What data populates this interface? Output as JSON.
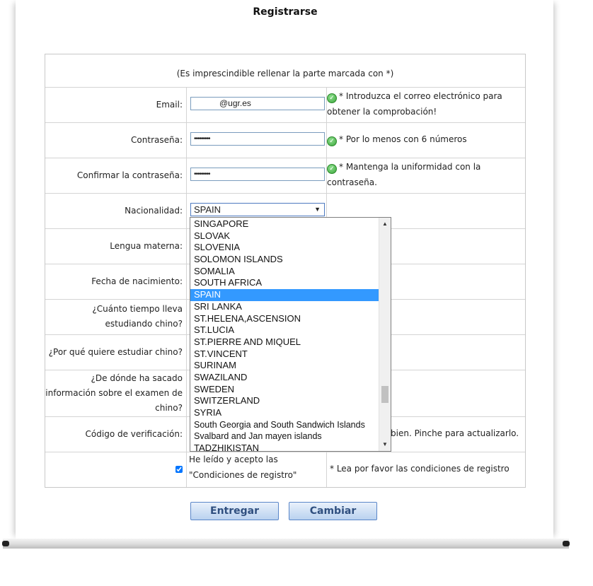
{
  "page": {
    "title": "Registrarse"
  },
  "form": {
    "note": "(Es imprescindible rellenar la parte marcada con *)",
    "email": {
      "label": "Email:",
      "value": "@ugr.es",
      "hint": "* Introduzca el correo electrónico para obtener la comprobación!"
    },
    "password": {
      "label": "Contraseña:",
      "value": "•••••••••",
      "hint": "* Por lo menos con 6 números"
    },
    "confirm": {
      "label": "Confirmar la contraseña:",
      "value": "•••••••••",
      "hint": "* Mantenga la uniformidad con la contraseña."
    },
    "nationality": {
      "label": "Nacionalidad:",
      "value": "SPAIN"
    },
    "mother_tongue": {
      "label": "Lengua materna:"
    },
    "birth_date": {
      "label": "Fecha de nacimiento:"
    },
    "study_time": {
      "label": "¿Cuánto tiempo lleva estudiando chino?"
    },
    "why_study": {
      "label": "¿Por qué quiere estudiar chino?"
    },
    "source": {
      "label": "¿De dónde ha sacado información sobre el examen de chino?"
    },
    "captcha": {
      "label": "Código de verificación:",
      "hint": "bien. Pinche para actualizarlo."
    },
    "terms": {
      "label_line1": "He leído y acepto las",
      "label_line2": "\"Condiciones de registro\"",
      "hint": "* Lea por favor las condiciones de registro",
      "checked": true
    }
  },
  "dropdown": {
    "options": [
      "SINGAPORE",
      "SLOVAK",
      "SLOVENIA",
      "SOLOMON ISLANDS",
      "SOMALIA",
      "SOUTH AFRICA",
      "SPAIN",
      "SRI LANKA",
      "ST.HELENA,ASCENSION",
      "ST.LUCIA",
      "ST.PIERRE AND MIQUEL",
      "ST.VINCENT",
      "SURINAM",
      "SWAZILAND",
      "SWEDEN",
      "SWITZERLAND",
      "SYRIA",
      "South Georgia and South Sandwich Islands",
      "Svalbard and Jan mayen islands",
      "TADZHIKISTAN"
    ],
    "selected": "SPAIN"
  },
  "buttons": {
    "submit": "Entregar",
    "reset": "Cambiar"
  },
  "icons": {
    "ok": "check-circle-icon",
    "arrow": "chevron-down-icon"
  },
  "colors": {
    "selected": "#3399ff",
    "button_text": "#2f4f7f",
    "ok_green": "#3aa53a"
  }
}
